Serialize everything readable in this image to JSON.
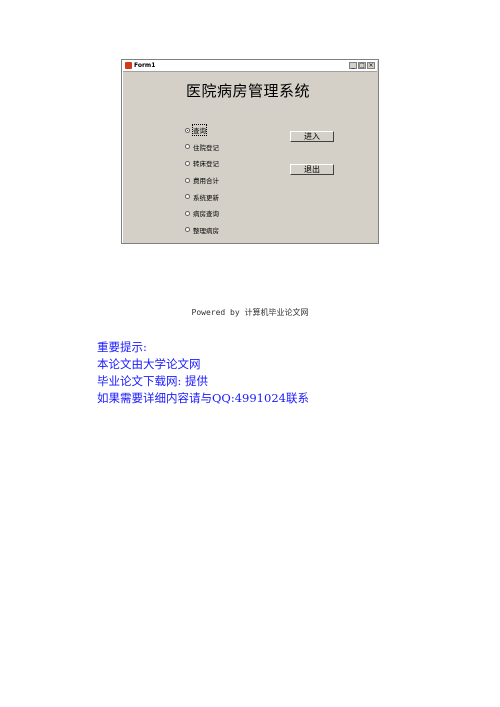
{
  "form": {
    "window_title": "Form1",
    "title_buttons": [
      "_",
      "□",
      "×"
    ],
    "heading": "医院病房管理系统",
    "radio_options": [
      {
        "label": "查询",
        "checked": true
      },
      {
        "label": "住院登记",
        "checked": false
      },
      {
        "label": "转床登记",
        "checked": false
      },
      {
        "label": "费用合计",
        "checked": false
      },
      {
        "label": "系统更新",
        "checked": false
      },
      {
        "label": "病房查询",
        "checked": false
      },
      {
        "label": "整理病房",
        "checked": false
      }
    ],
    "enter_button": "进入",
    "exit_button": "退出"
  },
  "powered_by": "Powered by 计算机毕业论文网",
  "notice": {
    "line1": "重要提示:",
    "line2": "本论文由大学论文网",
    "line3": "毕业论文下载网: 提供",
    "line4": "如果需要详细内容请与QQ:4991024联系"
  },
  "colors": {
    "form_background": "#d4d0c8",
    "notice_text": "#1a1aff"
  }
}
